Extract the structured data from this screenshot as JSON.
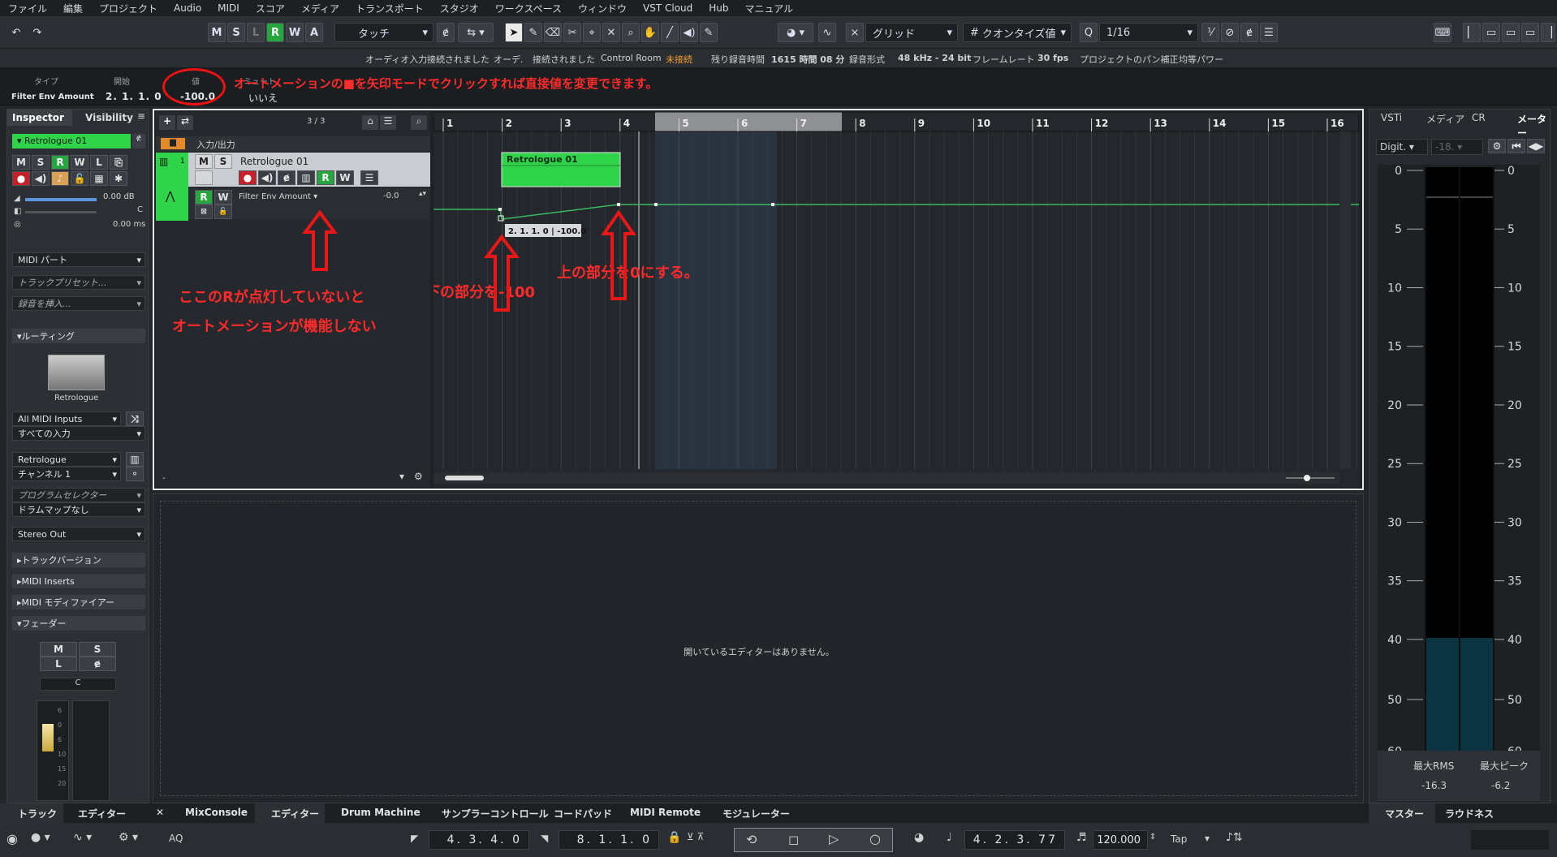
{
  "menu": [
    "ファイル",
    "編集",
    "プロジェクト",
    "Audio",
    "MIDI",
    "スコア",
    "メディア",
    "トランスポート",
    "スタジオ",
    "ワークスペース",
    "ウィンドウ",
    "VST Cloud",
    "Hub",
    "マニュアル"
  ],
  "toolbar": {
    "m": "M",
    "s": "S",
    "l": "L",
    "r": "R",
    "w": "W",
    "a": "A",
    "automation_mode": "タッチ",
    "snap_type": "グリッド",
    "quantize_type": "クオンタイズ値",
    "quantize_value": "1/16"
  },
  "status": {
    "audio_in_label": "オーディオ入力",
    "audio_in_value": "接続されました",
    "audio_out_label": "オーデ.",
    "audio_out_value": "接続されました",
    "control_room_label": "Control Room",
    "control_room_value": "未接続",
    "rec_time_label": "残り録音時間",
    "rec_time_value": "1615 時間 08 分",
    "rec_format_label": "録音形式",
    "rec_format_value": "48 kHz - 24 bit",
    "framerate_label": "フレームレート",
    "framerate_value": "30 fps",
    "pan_label": "プロジェクトのパン補正",
    "pan_value": "均等パワー"
  },
  "infoline": {
    "type_label": "タイプ",
    "type_value": "Filter Env Amount",
    "start_label": "開始",
    "start_value": "2. 1. 1.   0",
    "value_label": "値",
    "value_value": "-100.0",
    "mute_label": "ミュート",
    "mute_value": "いいえ"
  },
  "annotations": {
    "top": "オートメーションの■を矢印モードでクリックすれば直接値を変更できます。",
    "r1": "ここのRが点灯していないと",
    "r2": "オートメーションが機能しない",
    "bottom": "下の部分を-100",
    "top_point": "上の部分を0にする。"
  },
  "inspector": {
    "tab_inspector": "Inspector",
    "tab_visibility": "Visibility",
    "track_name": "Retrologue 01",
    "m": "M",
    "s": "S",
    "r": "R",
    "w": "W",
    "l": "L",
    "volume": "0.00 dB",
    "pan": "C",
    "delay": "0.00 ms",
    "midi_part": "MIDI パート",
    "track_preset": "トラックプリセット...",
    "insert_rec": "録音を挿入...",
    "routing": "ルーティング",
    "instrument": "Retrologue",
    "midi_in": "All MIDI Inputs",
    "midi_in_ch": "すべての入力",
    "out": "Retrologue",
    "channel": "チャンネル 1",
    "program": "プログラムセレクター",
    "drummap": "ドラムマップなし",
    "stereo_out": "Stereo Out",
    "track_version": "トラックバージョン",
    "midi_inserts": "MIDI Inserts",
    "midi_modifiers": "MIDI モディファイアー",
    "fader": "フェーダー",
    "fader_c": "C",
    "fader_scale": [
      "6",
      "0",
      "6",
      "10",
      "15",
      "20"
    ]
  },
  "tracklist": {
    "counter": "3 / 3",
    "folder": "入力/出力",
    "track_no": "1",
    "track_name": "Retrologue 01",
    "auto_param": "Filter Env Amount",
    "auto_value": "-0.0",
    "m": "M",
    "s": "S",
    "r": "R",
    "w": "W"
  },
  "ruler": [
    "1",
    "2",
    "3",
    "4",
    "5",
    "6",
    "7",
    "8",
    "9",
    "10",
    "11",
    "12",
    "13",
    "14",
    "15",
    "16"
  ],
  "arrange": {
    "part_name": "Retrologue 01",
    "tooltip": "2. 1. 1.  0 | -100.0"
  },
  "lower": {
    "empty_text": "開いているエディターはありません。"
  },
  "right": {
    "tabs": [
      "VSTi",
      "メディア",
      "CR",
      "メーター"
    ],
    "mode": "Digit.",
    "peak_field": "-18.",
    "scale": [
      "0",
      "5",
      "10",
      "15",
      "20",
      "25",
      "30",
      "35",
      "40",
      "50",
      "60"
    ],
    "rms_label": "最大RMS",
    "peak_label": "最大ピーク",
    "rms_value": "-16.3",
    "peak_value": "-6.2",
    "tab_master": "マスター",
    "tab_loudness": "ラウドネス"
  },
  "bottomtabs": {
    "track": "トラック",
    "editor": "エディター",
    "mixconsole": "MixConsole",
    "editor2": "エディター",
    "drum": "Drum Machine",
    "sampler": "サンプラーコントロール",
    "chordpad": "コードパッド",
    "remote": "MIDI Remote",
    "modulator": "モジュレーター"
  },
  "transport": {
    "left_locator": "4. 3. 4.   0",
    "right_locator": "8. 1. 1.   0",
    "position": "4. 2. 3.  77",
    "tempo": "120.000",
    "tap": "Tap",
    "aq": "AQ"
  }
}
